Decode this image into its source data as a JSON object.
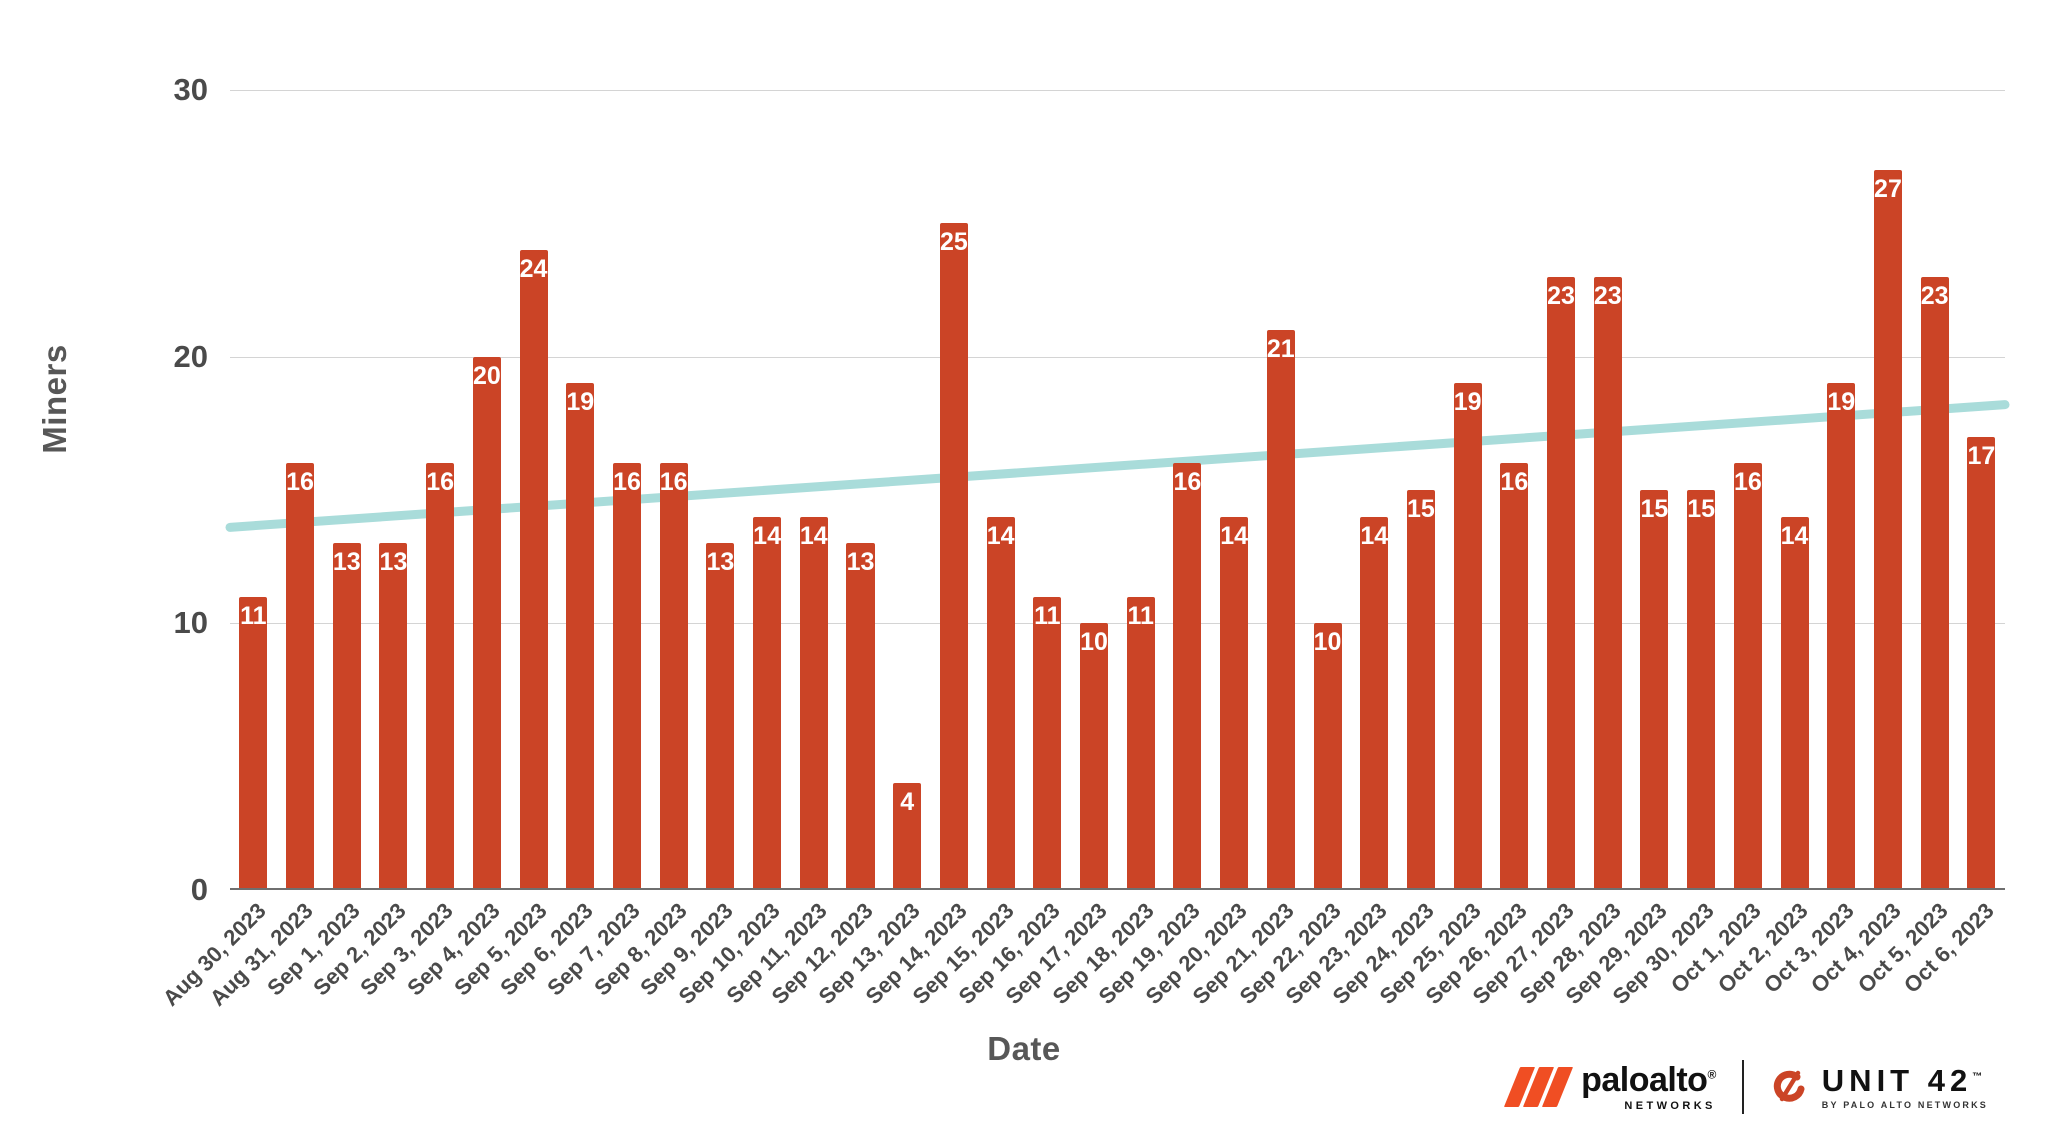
{
  "chart_data": {
    "type": "bar",
    "title": "",
    "xlabel": "Date",
    "ylabel": "Miners",
    "ylim": [
      0,
      30
    ],
    "yticks": [
      0,
      10,
      20,
      30
    ],
    "ytick_labels": [
      "0",
      "10",
      "20",
      "30"
    ],
    "grid": true,
    "legend": false,
    "bar_color": "#cb4426",
    "trendline_color": "#a9dcda",
    "categories": [
      "Aug 30, 2023",
      "Aug 31, 2023",
      "Sep 1, 2023",
      "Sep 2, 2023",
      "Sep 3, 2023",
      "Sep 4, 2023",
      "Sep 5, 2023",
      "Sep 6, 2023",
      "Sep 7, 2023",
      "Sep 8, 2023",
      "Sep 9, 2023",
      "Sep 10, 2023",
      "Sep 11, 2023",
      "Sep 12, 2023",
      "Sep 13, 2023",
      "Sep 14, 2023",
      "Sep 15, 2023",
      "Sep 16, 2023",
      "Sep 17, 2023",
      "Sep 18, 2023",
      "Sep 19, 2023",
      "Sep 20, 2023",
      "Sep 21, 2023",
      "Sep 22, 2023",
      "Sep 23, 2023",
      "Sep 24, 2023",
      "Sep 25, 2023",
      "Sep 26, 2023",
      "Sep 27, 2023",
      "Sep 28, 2023",
      "Sep 29, 2023",
      "Sep 30, 2023",
      "Oct 1, 2023",
      "Oct 2, 2023",
      "Oct 3, 2023",
      "Oct 4, 2023",
      "Oct 5, 2023",
      "Oct 6, 2023"
    ],
    "values": [
      11,
      16,
      13,
      13,
      16,
      20,
      24,
      19,
      16,
      16,
      13,
      14,
      14,
      13,
      4,
      25,
      14,
      11,
      10,
      11,
      16,
      14,
      21,
      10,
      14,
      15,
      19,
      16,
      23,
      23,
      15,
      15,
      16,
      14,
      19,
      27,
      23,
      17
    ],
    "data_labels": [
      "11",
      "16",
      "13",
      "13",
      "16",
      "20",
      "24",
      "19",
      "16",
      "16",
      "13",
      "14",
      "14",
      "13",
      "4",
      "25",
      "14",
      "11",
      "10",
      "11",
      "16",
      "14",
      "21",
      "10",
      "14",
      "15",
      "19",
      "16",
      "23",
      "23",
      "15",
      "15",
      "16",
      "14",
      "19",
      "27",
      "23",
      "17"
    ],
    "trendline": {
      "type": "linear",
      "start_value": 13.6,
      "end_value": 18.2
    }
  },
  "branding": {
    "paloalto": {
      "name": "paloalto",
      "registered": "®",
      "tagline": "NETWORKS"
    },
    "unit42": {
      "name": "UNIT 42",
      "trademark": "™",
      "tagline": "BY PALO ALTO NETWORKS"
    }
  }
}
